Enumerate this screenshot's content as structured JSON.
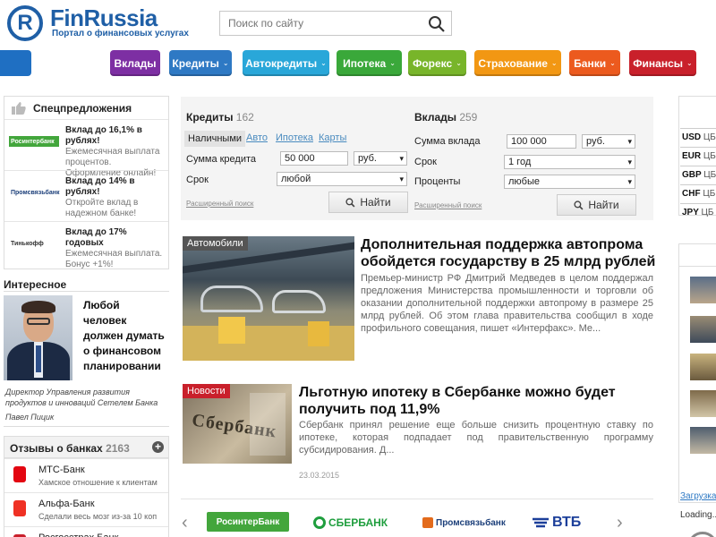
{
  "header": {
    "logo_letter": "R",
    "logo_title": "FinRussia",
    "logo_subtitle": "Портал о финансовых услугах",
    "search_placeholder": "Поиск по сайту"
  },
  "nav": [
    {
      "label": "Вклады",
      "color": "#7d2fa3",
      "chev": ""
    },
    {
      "label": "Кредиты",
      "color": "#2e79c4",
      "chev": "⌄"
    },
    {
      "label": "Автокредиты",
      "color": "#29a7d9",
      "chev": "⌄"
    },
    {
      "label": "Ипотека",
      "color": "#3aa83a",
      "chev": "⌄"
    },
    {
      "label": "Форекс",
      "color": "#78b52a",
      "chev": "⌄"
    },
    {
      "label": "Страхование",
      "color": "#f29713",
      "chev": "⌄"
    },
    {
      "label": "Банки",
      "color": "#ec5a1e",
      "chev": "⌄"
    },
    {
      "label": "Финансы",
      "color": "#c9202b",
      "chev": "⌄"
    }
  ],
  "special": {
    "title": "Спецпредложения",
    "items": [
      {
        "bank": "Росинтербанк",
        "title": "Вклад до 16,1% в рублях!",
        "desc": "Ежемесячная выплата процентов. Оформление онлайн!"
      },
      {
        "bank": "Промсвязьбанк",
        "title": "Вклад до 14% в рублях!",
        "desc": "Откройте вклад в надежном банке!"
      },
      {
        "bank": "Тинькофф",
        "title": "Вклад до 17% годовых",
        "desc": "Ежемесячная выплата. Бонус +1%!"
      }
    ]
  },
  "interesting": {
    "title": "Интересное",
    "quote": "Любой человек должен думать о финансовом планировании",
    "caption": "Директор Управления развития продуктов и инноваций Сетелем Банка",
    "name": "Павел Пицик"
  },
  "reviews": {
    "title": "Отзывы о банках",
    "count": "2163",
    "items": [
      {
        "bank": "МТС-Банк",
        "text": "Хамское отношение к клиентам"
      },
      {
        "bank": "Альфа-Банк",
        "text": "Сделали весь мозг из-за 10 коп"
      },
      {
        "bank": "Росгосстрах Банк",
        "text": ""
      }
    ]
  },
  "credits": {
    "title": "Кредиты",
    "count": "162",
    "tabs": [
      "Наличными",
      "Авто",
      "Ипотека",
      "Карты"
    ],
    "sum_label": "Сумма кредита",
    "sum_value": "50 000",
    "currency": "руб.",
    "term_label": "Срок",
    "term_value": "любой",
    "ext": "Расширенный поиск",
    "find": "Найти"
  },
  "deposits": {
    "title": "Вклады",
    "count": "259",
    "sum_label": "Сумма вклада",
    "sum_value": "100 000",
    "currency": "руб.",
    "term_label": "Срок",
    "term_value": "1 год",
    "pct_label": "Проценты",
    "pct_value": "любые",
    "ext": "Расширенный поиск",
    "find": "Найти"
  },
  "news": [
    {
      "tag": "Автомобили",
      "tag_color": "#555555",
      "title": "Дополнительная поддержка автопрома обойдется государству в 25 млрд рублей",
      "text": "Премьер-министр РФ Дмитрий Медведев в целом поддержал предложения Министерства промышленности и торговли об оказании дополнительной поддержки автопрому в размере 25 млрд рублей. Об этом глава правительства сообщил в ходе профильного совещания, пишет «Интерфакс». Ме..."
    },
    {
      "tag": "Новости",
      "tag_color": "#c9202b",
      "title": "Льготную ипотеку в Сбербанке можно будет получить под 11,9%",
      "text": "Сбербанк принял решение еще больше снизить процентную ставку по ипотеке, которая подпадает под правительственную программу субсидирования. Д...",
      "image_text": "Сбербанк",
      "date": "23.03.2015"
    }
  ],
  "partners": [
    "РосинтерБанк",
    "СБЕРБАНК",
    "Промсвязьбанк",
    "ВТБ"
  ],
  "rates": [
    {
      "code": "USD",
      "src": "ЦБ"
    },
    {
      "code": "EUR",
      "src": "ЦБ"
    },
    {
      "code": "GBP",
      "src": "ЦБ"
    },
    {
      "code": "CHF",
      "src": "ЦБ"
    },
    {
      "code": "JPY",
      "src": "ЦБ"
    }
  ],
  "right_bottom": {
    "link": "Загрузка...",
    "loading": "Loading..."
  }
}
